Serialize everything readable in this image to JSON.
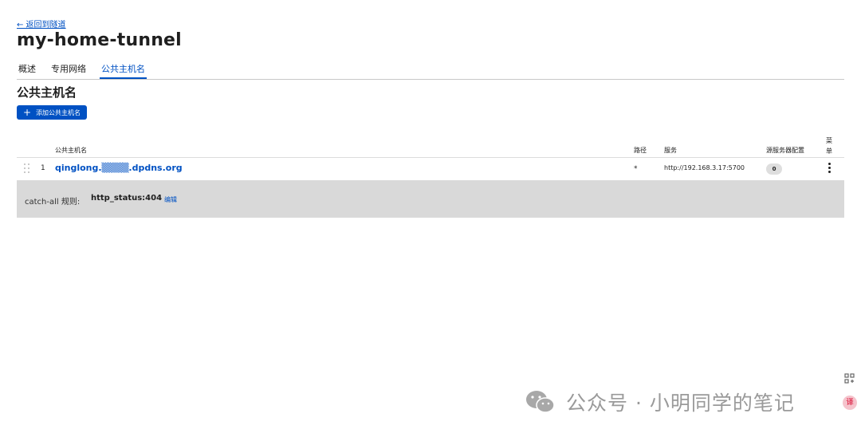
{
  "nav": {
    "back_link": "← 返回到隧道"
  },
  "page": {
    "title": "my-home-tunnel"
  },
  "tabs": [
    {
      "label": "概述",
      "active": false
    },
    {
      "label": "专用网络",
      "active": false
    },
    {
      "label": "公共主机名",
      "active": true
    }
  ],
  "section": {
    "title": "公共主机名",
    "add_button_label": "添加公共主机名"
  },
  "table": {
    "headers": {
      "hostname": "公共主机名",
      "path": "路径",
      "service": "服务",
      "origin_config": "源服务器配置",
      "menu": "菜单"
    },
    "rows": [
      {
        "index": "1",
        "hostname": "qinglong.▒▒▒▒.dpdns.org",
        "path": "*",
        "service": "http://192.168.3.17:5700",
        "origin_count": "0"
      }
    ]
  },
  "catch_all": {
    "label": "catch-all 规则:",
    "value": "http_status:404",
    "edit_label": "编辑"
  },
  "watermark": {
    "text": "公众号 · 小明同学的笔记",
    "icon": "wechat-icon"
  },
  "side_icons": {
    "translate_label": "译"
  },
  "colors": {
    "accent": "#0051c3",
    "catchall_bg": "#d9d9d9",
    "badge_bg": "#dedede"
  }
}
